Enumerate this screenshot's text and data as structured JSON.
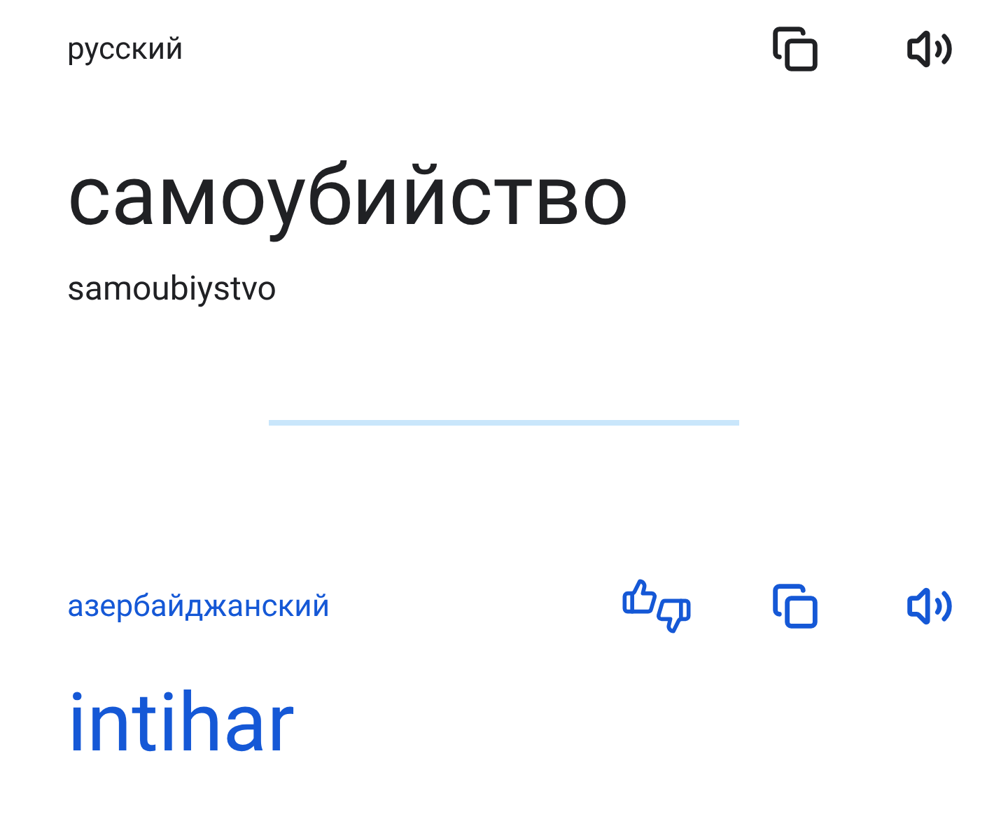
{
  "source": {
    "language": "русский",
    "text": "самоубийство",
    "transliteration": "samoubiystvo"
  },
  "target": {
    "language": "азербайджанский",
    "text": "intihar"
  }
}
